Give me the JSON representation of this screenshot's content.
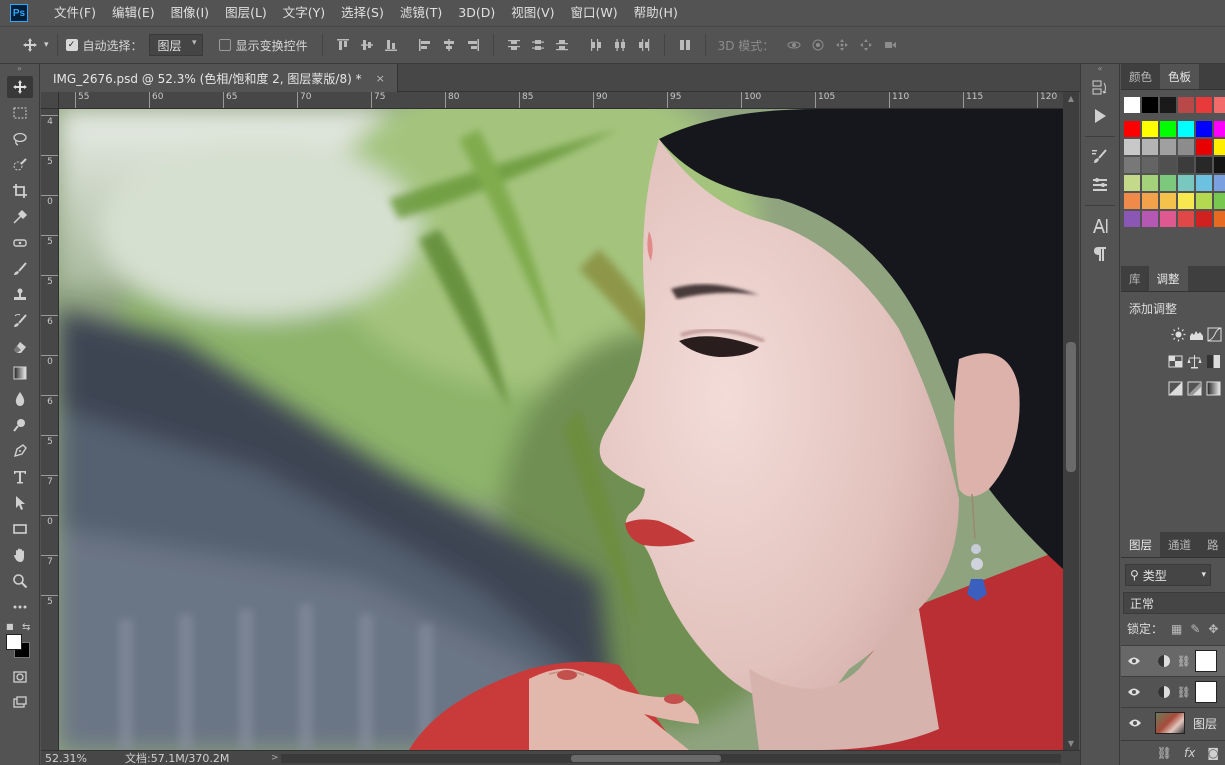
{
  "app": {
    "logo": "Ps"
  },
  "menu": [
    "文件(F)",
    "编辑(E)",
    "图像(I)",
    "图层(L)",
    "文字(Y)",
    "选择(S)",
    "滤镜(T)",
    "3D(D)",
    "视图(V)",
    "窗口(W)",
    "帮助(H)"
  ],
  "options": {
    "auto_select_label": "自动选择：",
    "auto_select_checked": true,
    "auto_select_target": "图层",
    "show_transform_label": "显示变换控件",
    "show_transform_checked": false,
    "mode_3d_label": "3D 模式："
  },
  "document": {
    "tab_title": "IMG_2676.psd @ 52.3% (色相/饱和度 2, 图层蒙版/8) *",
    "close_glyph": "×"
  },
  "rulers": {
    "horizontal": [
      "55",
      "60",
      "65",
      "70",
      "75",
      "80",
      "85",
      "90",
      "95",
      "100",
      "105",
      "110",
      "115",
      "120"
    ],
    "vertical": [
      "4",
      "5",
      "0",
      "5",
      "5",
      "6",
      "0",
      "6",
      "5",
      "7",
      "0",
      "7",
      "5"
    ]
  },
  "status": {
    "zoom": "52.31%",
    "doc_info": "文档:57.1M/370.2M",
    "arrow": ">"
  },
  "panels": {
    "color_tabs": [
      "颜色",
      "色板"
    ],
    "color_active": "色板",
    "swatch_rows": [
      [
        "#ffffff",
        "#000000",
        "#1a1a1a",
        "#b94848",
        "#e83a3a",
        "#f26a6a"
      ],
      [
        "#ff0000",
        "#ffff00",
        "#00ff00",
        "#00ffff",
        "#0000ff",
        "#ff00ff"
      ],
      [
        "#c8c8c8",
        "#b4b4b4",
        "#a0a0a0",
        "#8c8c8c",
        "#e80000",
        "#ffee00"
      ],
      [
        "#787878",
        "#646464",
        "#505050",
        "#3c3c3c",
        "#282828",
        "#141414"
      ],
      [
        "#c5d98a",
        "#a4d27a",
        "#7cc87c",
        "#78c8c0",
        "#6cc0e0",
        "#7aa0e0"
      ],
      [
        "#f08a4a",
        "#f2a24a",
        "#f4c24a",
        "#f8e850",
        "#b4d850",
        "#78c850"
      ],
      [
        "#8a58b4",
        "#b458b4",
        "#e05890",
        "#e04848",
        "#d02020",
        "#e86a20"
      ]
    ],
    "adjust_tabs": [
      "库",
      "调整"
    ],
    "adjust_active": "调整",
    "adjust_title": "添加调整",
    "layers_tabs": [
      "图层",
      "通道",
      "路"
    ],
    "layers_active": "图层",
    "kind_filter": "类型",
    "blend_mode": "正常",
    "lock_label": "锁定：",
    "layers": [
      {
        "type": "adjustment",
        "name": "",
        "visible": true,
        "selected": true
      },
      {
        "type": "adjustment",
        "name": "",
        "visible": true,
        "selected": false
      },
      {
        "type": "image",
        "name": "图层",
        "visible": true,
        "selected": false
      }
    ]
  }
}
